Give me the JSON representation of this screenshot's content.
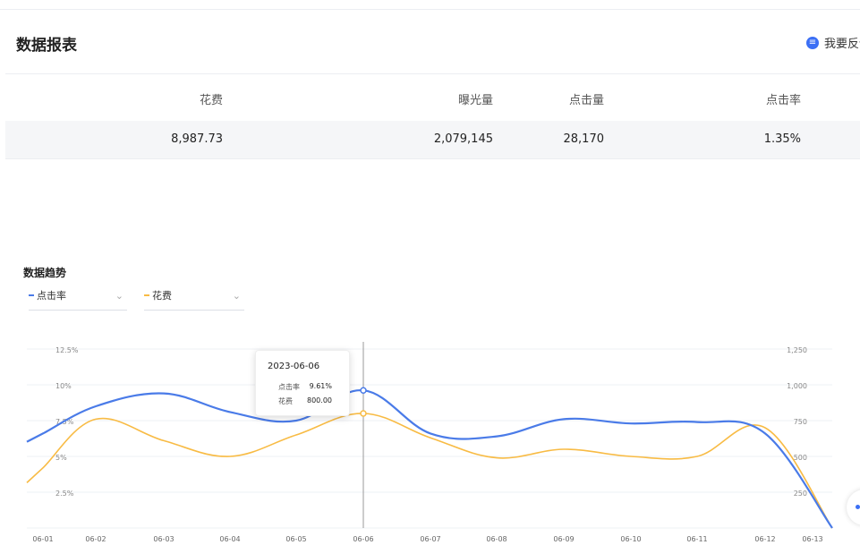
{
  "report": {
    "title": "数据报表",
    "feedback_label": "我要反馈",
    "columns": [
      "花费",
      "曝光量",
      "点击量",
      "点击率"
    ],
    "row": [
      "8,987.73",
      "2,079,145",
      "28,170",
      "1.35%"
    ]
  },
  "trend": {
    "title": "数据趋势",
    "selectors": [
      {
        "label": "点击率",
        "color": "#4a7be8"
      },
      {
        "label": "花费",
        "color": "#f8bb44"
      }
    ]
  },
  "chart_data": {
    "type": "line",
    "x": [
      "06-01",
      "06-02",
      "06-03",
      "06-04",
      "06-05",
      "06-06",
      "06-07",
      "06-08",
      "06-09",
      "06-10",
      "06-11",
      "06-12",
      "06-13"
    ],
    "series": [
      {
        "name": "点击率",
        "color": "#4a7be8",
        "axis": "left",
        "values": [
          6.6,
          8.5,
          9.4,
          8.1,
          7.5,
          9.61,
          6.6,
          6.4,
          7.6,
          7.3,
          7.4,
          6.6,
          0
        ]
      },
      {
        "name": "花费",
        "color": "#f8bb44",
        "axis": "right",
        "values": [
          420,
          760,
          610,
          500,
          650,
          800,
          630,
          490,
          550,
          500,
          500,
          700,
          0
        ]
      }
    ],
    "y_left": {
      "ticks": [
        "12.5%",
        "10%",
        "7.5%",
        "5%",
        "2.5%"
      ],
      "range": [
        0,
        12.5
      ]
    },
    "y_right": {
      "ticks": [
        "1,250",
        "1,000",
        "750",
        "500",
        "250"
      ],
      "range": [
        0,
        1250
      ]
    },
    "grid": true
  },
  "tooltip": {
    "date": "2023-06-06",
    "rows": [
      {
        "label": "点击率",
        "value": "9.61%"
      },
      {
        "label": "花费",
        "value": "800.00"
      }
    ]
  }
}
